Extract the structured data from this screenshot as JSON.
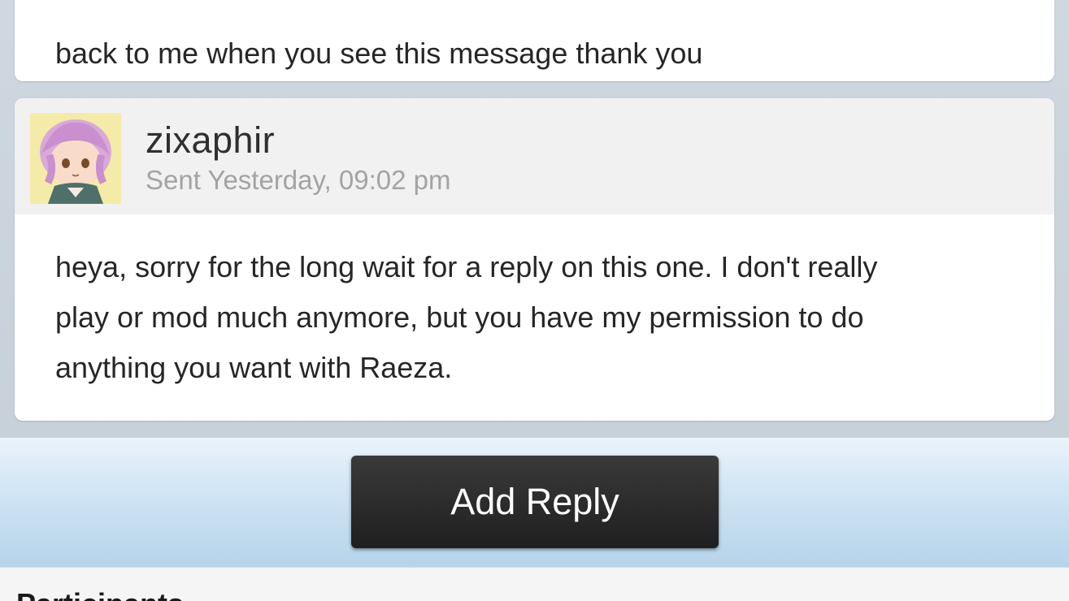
{
  "previous_message": {
    "text": "back to me when you see this message thank you"
  },
  "message": {
    "author": "zixaphir",
    "sent": "Sent Yesterday, 09:02 pm",
    "avatar_icon": "anime-avatar-icon",
    "lines": [
      "heya, sorry for the long wait for a reply on this one. I don't really",
      "play or mod much anymore, but you have my permission to do",
      "anything you want with Raeza."
    ]
  },
  "reply": {
    "button_label": "Add Reply"
  },
  "participants": {
    "label": "Participants"
  }
}
